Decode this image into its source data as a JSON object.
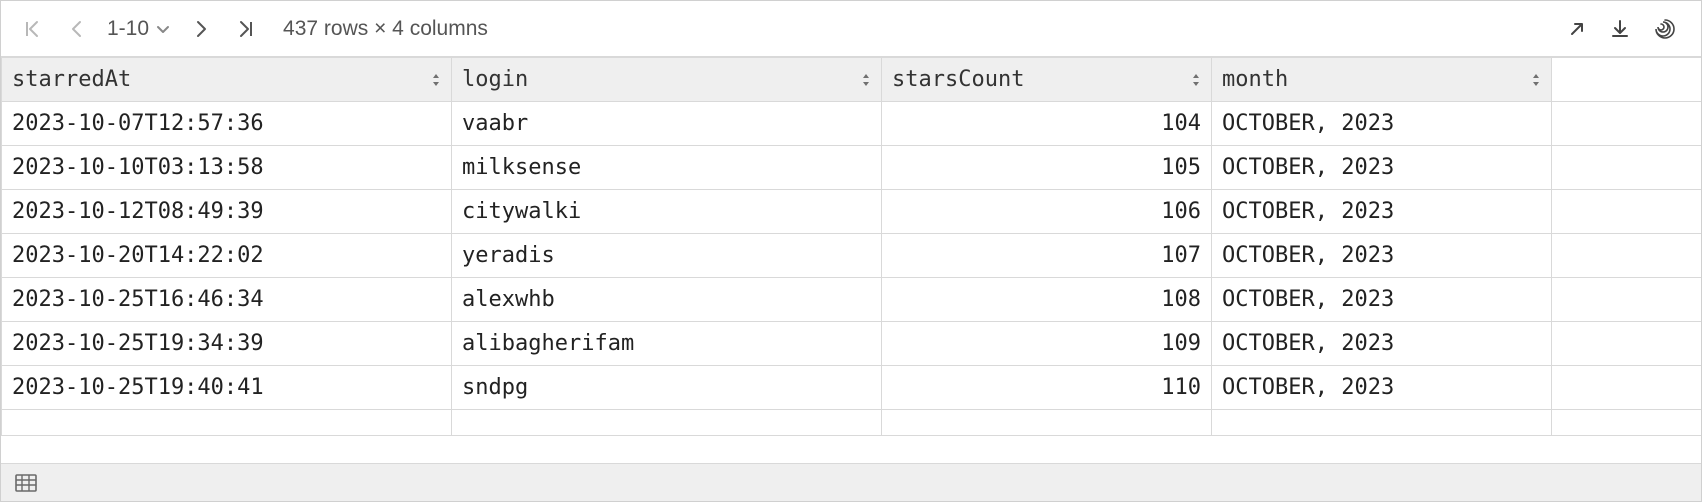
{
  "toolbar": {
    "range_label": "1-10",
    "row_info": "437 rows × 4 columns"
  },
  "columns": [
    {
      "key": "starredAt",
      "label": "starredAt",
      "align": "left",
      "cls": "col-starred"
    },
    {
      "key": "login",
      "label": "login",
      "align": "left",
      "cls": "col-login"
    },
    {
      "key": "starsCount",
      "label": "starsCount",
      "align": "right",
      "cls": "col-stars"
    },
    {
      "key": "month",
      "label": "month",
      "align": "left",
      "cls": "col-month"
    }
  ],
  "rows": [
    {
      "starredAt": "2023-10-07T12:57:36",
      "login": "vaabr",
      "starsCount": 104,
      "month": "OCTOBER, 2023"
    },
    {
      "starredAt": "2023-10-10T03:13:58",
      "login": "milksense",
      "starsCount": 105,
      "month": "OCTOBER, 2023"
    },
    {
      "starredAt": "2023-10-12T08:49:39",
      "login": "citywalki",
      "starsCount": 106,
      "month": "OCTOBER, 2023"
    },
    {
      "starredAt": "2023-10-20T14:22:02",
      "login": "yeradis",
      "starsCount": 107,
      "month": "OCTOBER, 2023"
    },
    {
      "starredAt": "2023-10-25T16:46:34",
      "login": "alexwhb",
      "starsCount": 108,
      "month": "OCTOBER, 2023"
    },
    {
      "starredAt": "2023-10-25T19:34:39",
      "login": "alibagherifam",
      "starsCount": 109,
      "month": "OCTOBER, 2023"
    },
    {
      "starredAt": "2023-10-25T19:40:41",
      "login": "sndpg",
      "starsCount": 110,
      "month": "OCTOBER, 2023"
    }
  ]
}
